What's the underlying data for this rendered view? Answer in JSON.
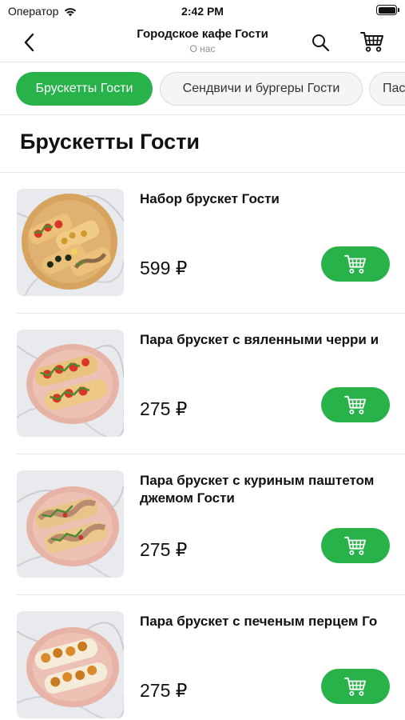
{
  "status_bar": {
    "carrier": "Оператор",
    "time": "2:42 PM"
  },
  "nav": {
    "title": "Городское кафе Гости",
    "subtitle": "О нас"
  },
  "categories": [
    {
      "label": "Брускетты Гости",
      "active": true
    },
    {
      "label": "Сендвичи и бургеры Гости",
      "active": false
    },
    {
      "label": "Пас",
      "active": false
    }
  ],
  "section": {
    "title": "Брускетты Гости"
  },
  "products": [
    {
      "name": "Набор брускет Гости",
      "price": "599 ₽"
    },
    {
      "name": "Пара брускет с вяленными черри и",
      "price": "275 ₽"
    },
    {
      "name": "Пара брускет с куриным паштетом\nджемом Гости",
      "price": "275 ₽"
    },
    {
      "name": "Пара брускет с печеным перцем Го",
      "price": "275 ₽"
    }
  ],
  "colors": {
    "accent": "#27b24a",
    "divider": "#e6e6e6",
    "subtitle": "#8e8e93"
  },
  "icons": {
    "back": "chevron-left-icon",
    "search": "search-icon",
    "cart": "cart-icon",
    "add_to_cart": "cart-plus-icon"
  }
}
